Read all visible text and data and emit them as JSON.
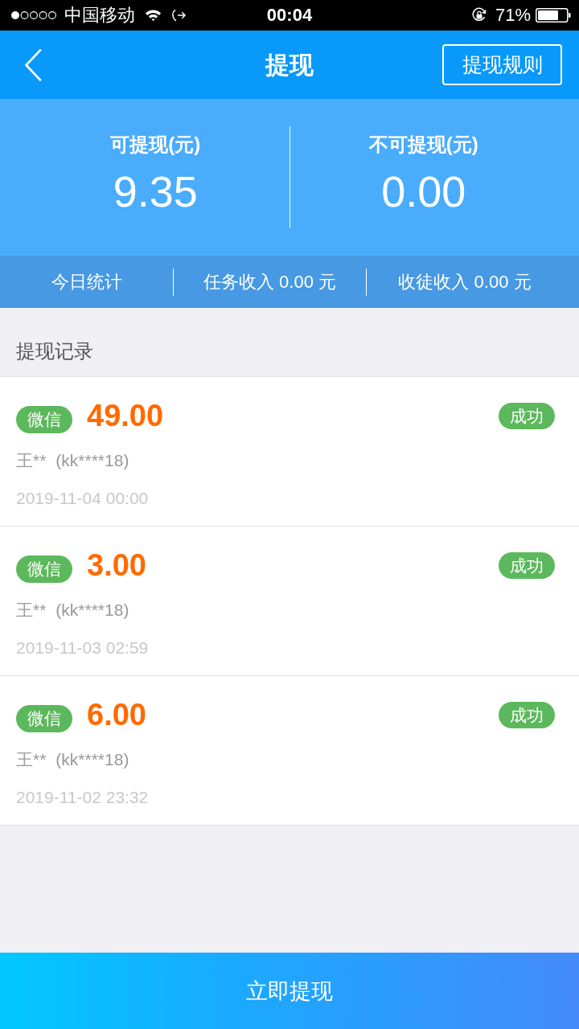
{
  "status_bar": {
    "carrier": "中国移动",
    "time": "00:04",
    "battery": "71%"
  },
  "nav": {
    "title": "提现",
    "rules_button": "提现规则"
  },
  "balances": [
    {
      "label": "可提现(元)",
      "amount": "9.35"
    },
    {
      "label": "不可提现(元)",
      "amount": "0.00"
    }
  ],
  "today_stats": [
    "今日统计",
    "任务收入 0.00 元",
    "收徒收入 0.00 元"
  ],
  "records_title": "提现记录",
  "records": [
    {
      "channel": "微信",
      "amount": "49.00",
      "status": "成功",
      "name": "王**",
      "account": "(kk****18)",
      "time": "2019-11-04 00:00"
    },
    {
      "channel": "微信",
      "amount": "3.00",
      "status": "成功",
      "name": "王**",
      "account": "(kk****18)",
      "time": "2019-11-03 02:59"
    },
    {
      "channel": "微信",
      "amount": "6.00",
      "status": "成功",
      "name": "王**",
      "account": "(kk****18)",
      "time": "2019-11-02 23:32"
    }
  ],
  "submit_button": "立即提现"
}
